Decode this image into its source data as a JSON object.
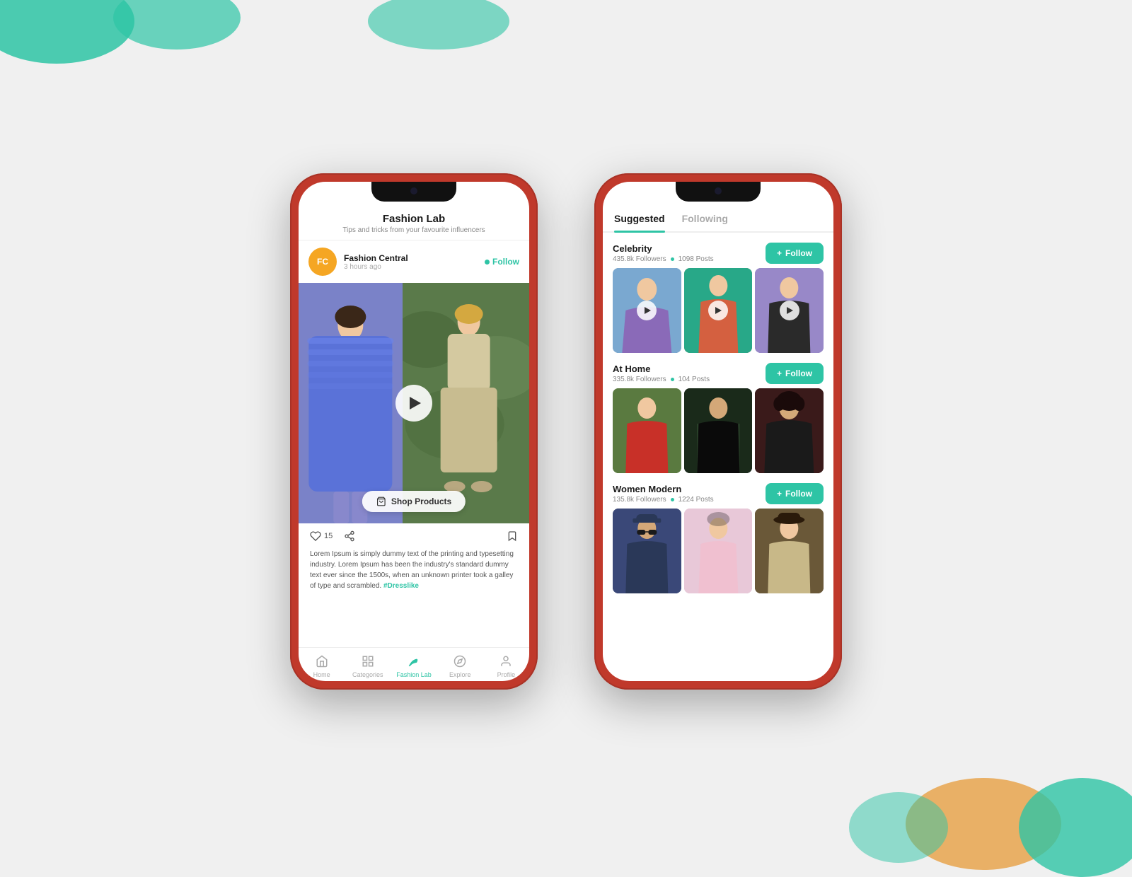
{
  "background": {
    "blobs": [
      "tl",
      "tc",
      "tr",
      "br-orange",
      "br-green",
      "br-green2"
    ]
  },
  "phone1": {
    "header": {
      "title": "Fashion Lab",
      "subtitle": "Tips and tricks from your favourite influencers"
    },
    "user": {
      "initials": "FC",
      "name": "Fashion Central",
      "time": "3 hours ago",
      "follow_label": "Follow"
    },
    "shop_button": "Shop Products",
    "actions": {
      "likes": "15"
    },
    "caption": "Lorem Ipsum is simply dummy text of the printing and typesetting industry. Lorem Ipsum has been the industry's standard dummy text ever since the 1500s, when an unknown printer took a galley of type and scrambled.",
    "hashtag": "#Dresslike",
    "nav": [
      {
        "label": "Home",
        "icon": "home"
      },
      {
        "label": "Categories",
        "icon": "grid"
      },
      {
        "label": "Fashion Lab",
        "icon": "leaf",
        "active": true
      },
      {
        "label": "Explore",
        "icon": "compass"
      },
      {
        "label": "Profile",
        "icon": "person"
      }
    ]
  },
  "phone2": {
    "tabs": [
      {
        "label": "Suggested",
        "active": true
      },
      {
        "label": "Following",
        "active": false
      }
    ],
    "sections": [
      {
        "title": "Celebrity",
        "followers": "435.8k Followers",
        "posts": "1098 Posts",
        "follow_label": "Follow",
        "images": [
          "celebrity-1",
          "celebrity-2",
          "celebrity-3"
        ]
      },
      {
        "title": "At Home",
        "followers": "335.8k Followers",
        "posts": "104 Posts",
        "follow_label": "Follow",
        "images": [
          "athome-1",
          "athome-2",
          "athome-3"
        ]
      },
      {
        "title": "Women Modern",
        "followers": "135.8k Followers",
        "posts": "1224 Posts",
        "follow_label": "Follow",
        "images": [
          "women-1",
          "women-2",
          "women-3"
        ]
      }
    ]
  }
}
